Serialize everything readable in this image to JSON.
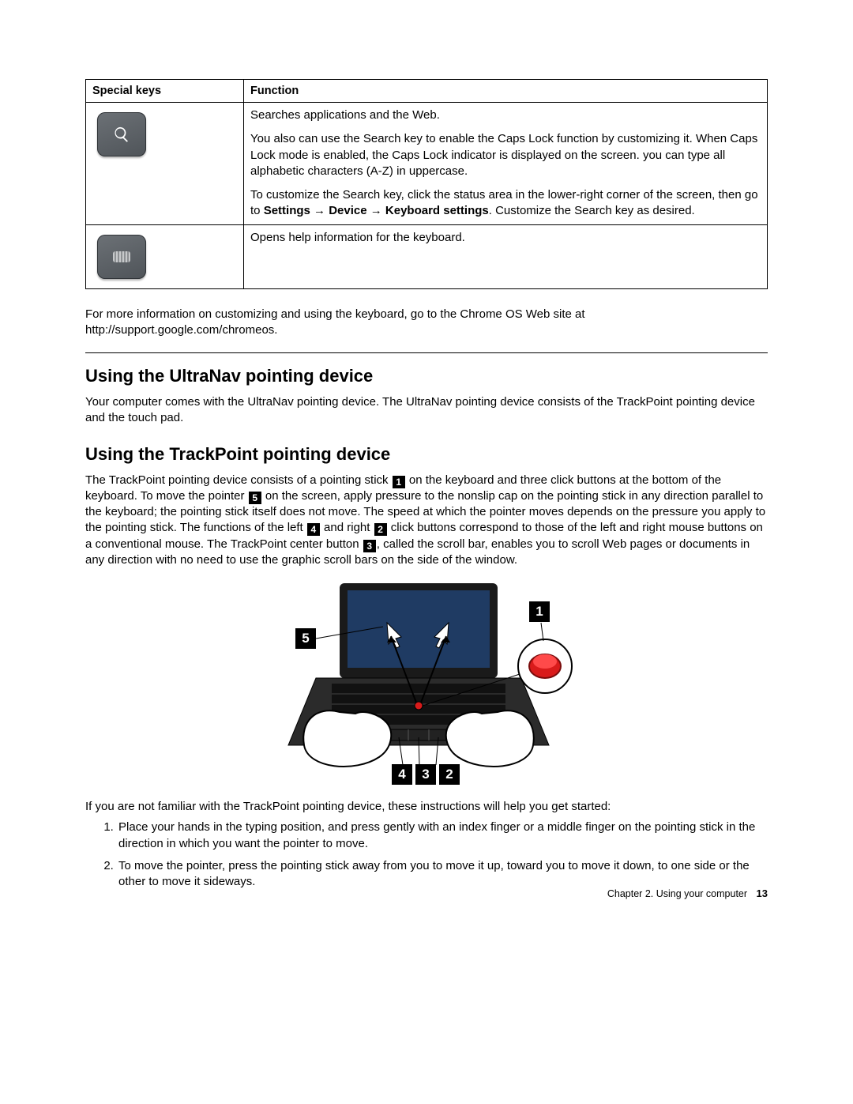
{
  "table": {
    "head_keys": "Special keys",
    "head_func": "Function",
    "row_search": {
      "p1": "Searches applications and the Web.",
      "p2": "You also can use the Search key to enable the Caps Lock function by customizing it. When Caps Lock mode is enabled, the Caps Lock indicator is displayed on the screen. you can type all alphabetic characters (A-Z) in uppercase.",
      "p3a": "To customize the Search key, click the status area in the lower-right corner of the screen, then go to ",
      "p3b": "Settings → Device → Keyboard settings",
      "p3c": ". Customize the Search key as desired."
    },
    "row_help": {
      "text": "Opens help information for the keyboard."
    }
  },
  "more_info": "For more information on customizing and using the keyboard, go to the Chrome OS Web site at http://support.google.com/chromeos.",
  "h_ultranav": "Using the UltraNav pointing device",
  "ultranav_p": "Your computer comes with the UltraNav pointing device. The UltraNav pointing device consists of the TrackPoint pointing device and the touch pad.",
  "h_trackpoint": "Using the TrackPoint pointing device",
  "tp": {
    "a": "The TrackPoint pointing device consists of a pointing stick ",
    "b": " on the keyboard and three click buttons at the bottom of the keyboard. To move the pointer ",
    "c": " on the screen, apply pressure to the nonslip cap on the pointing stick in any direction parallel to the keyboard; the pointing stick itself does not move. The speed at which the pointer moves depends on the pressure you apply to the pointing stick. The functions of the left ",
    "d": " and right ",
    "e": " click buttons correspond to those of the left and right mouse buttons on a conventional mouse. The TrackPoint center button ",
    "f": ", called the scroll bar, enables you to scroll Web pages or documents in any direction with no need to use the graphic scroll bars on the side of the window."
  },
  "nums": {
    "n1": "1",
    "n2": "2",
    "n3": "3",
    "n4": "4",
    "n5": "5"
  },
  "after_illus": "If you are not familiar with the TrackPoint pointing device, these instructions will help you get started:",
  "steps": {
    "s1": "Place your hands in the typing position, and press gently with an index finger or a middle finger on the pointing stick in the direction in which you want the pointer to move.",
    "s2": "To move the pointer, press the pointing stick away from you to move it up, toward you to move it down, to one side or the other to move it sideways."
  },
  "footer_chapter": "Chapter 2. Using your computer",
  "footer_page": "13"
}
